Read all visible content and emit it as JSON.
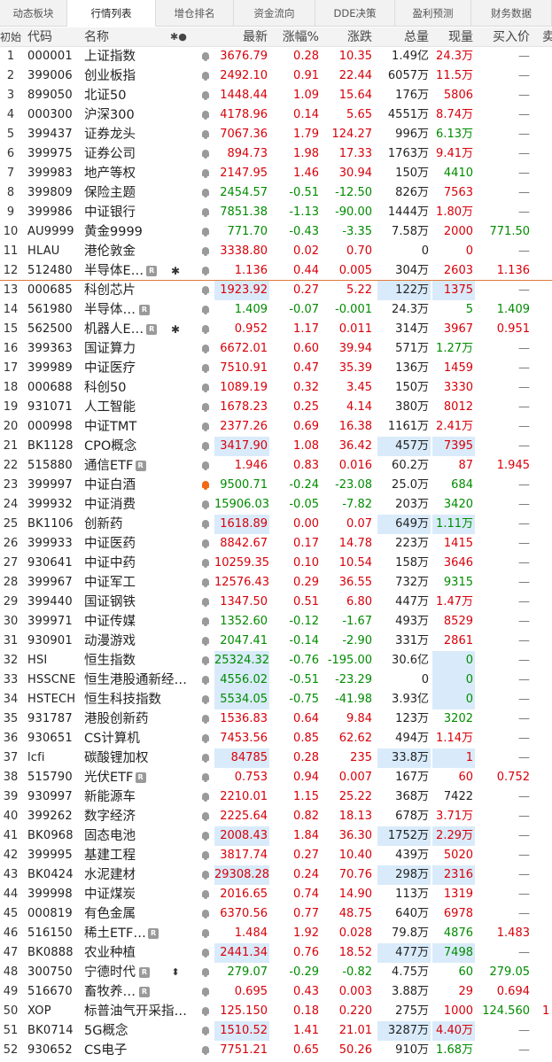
{
  "tabs": [
    "动态板块",
    "行情列表",
    "增仓排名",
    "资金流向",
    "DDE决策",
    "盈利预测",
    "财务数据"
  ],
  "active_tab": 1,
  "header": {
    "idx": "初始",
    "code": "代码",
    "name": "名称",
    "marks": "✱●",
    "price": "最新",
    "pct": "涨幅%",
    "chg": "涨跌",
    "vol": "总量",
    "now": "现量",
    "bid": "买入价",
    "extra": "卖"
  },
  "colors": {
    "up": "#d8000a",
    "down": "#008c00",
    "flat": "#222222",
    "highlight": "#d9ebfa",
    "separator": "#e07a3b",
    "alert_bell": "#f06a14"
  },
  "rows": [
    {
      "idx": "1",
      "code": "000001",
      "name": "上证指数",
      "price": "3676.79",
      "pct": "0.28",
      "chg": "10.35",
      "vol": "1.49亿",
      "now": "24.3万",
      "bid": "—",
      "dir": "up",
      "now_dir": "up"
    },
    {
      "idx": "2",
      "code": "399006",
      "name": "创业板指",
      "price": "2492.10",
      "pct": "0.91",
      "chg": "22.44",
      "vol": "6057万",
      "now": "11.5万",
      "bid": "—",
      "dir": "up",
      "now_dir": "up"
    },
    {
      "idx": "3",
      "code": "899050",
      "name": "北证50",
      "price": "1448.44",
      "pct": "1.09",
      "chg": "15.64",
      "vol": "176万",
      "now": "5806",
      "bid": "—",
      "dir": "up",
      "now_dir": "up"
    },
    {
      "idx": "4",
      "code": "000300",
      "name": "沪深300",
      "price": "4178.96",
      "pct": "0.14",
      "chg": "5.65",
      "vol": "4551万",
      "now": "8.74万",
      "bid": "—",
      "dir": "up",
      "now_dir": "up"
    },
    {
      "idx": "5",
      "code": "399437",
      "name": "证券龙头",
      "price": "7067.36",
      "pct": "1.79",
      "chg": "124.27",
      "vol": "996万",
      "now": "6.13万",
      "bid": "—",
      "dir": "up",
      "now_dir": "down"
    },
    {
      "idx": "6",
      "code": "399975",
      "name": "证券公司",
      "price": "894.73",
      "pct": "1.98",
      "chg": "17.33",
      "vol": "1763万",
      "now": "9.41万",
      "bid": "—",
      "dir": "up",
      "now_dir": "up"
    },
    {
      "idx": "7",
      "code": "399983",
      "name": "地产等权",
      "price": "2147.95",
      "pct": "1.46",
      "chg": "30.94",
      "vol": "150万",
      "now": "4410",
      "bid": "—",
      "dir": "up",
      "now_dir": "down"
    },
    {
      "idx": "8",
      "code": "399809",
      "name": "保险主题",
      "price": "2454.57",
      "pct": "-0.51",
      "chg": "-12.50",
      "vol": "826万",
      "now": "7563",
      "bid": "—",
      "dir": "down",
      "now_dir": "up"
    },
    {
      "idx": "9",
      "code": "399986",
      "name": "中证银行",
      "price": "7851.38",
      "pct": "-1.13",
      "chg": "-90.00",
      "vol": "1444万",
      "now": "1.80万",
      "bid": "—",
      "dir": "down",
      "now_dir": "up"
    },
    {
      "idx": "10",
      "code": "AU9999",
      "name": "黄金9999",
      "price": "771.70",
      "pct": "-0.43",
      "chg": "-3.35",
      "vol": "7.58万",
      "now": "2000",
      "bid": "771.50",
      "dir": "down",
      "now_dir": "up",
      "bid_dir": "down"
    },
    {
      "idx": "11",
      "code": "HLAU",
      "name": "港伦敦金",
      "price": "3338.80",
      "pct": "0.02",
      "chg": "0.70",
      "vol": "0",
      "now": "0",
      "bid": "—",
      "dir": "up",
      "now_dir": "up"
    },
    {
      "idx": "12",
      "code": "512480",
      "name": "半导体E…",
      "badge": "R",
      "star": "✱",
      "price": "1.136",
      "pct": "0.44",
      "chg": "0.005",
      "vol": "304万",
      "now": "2603",
      "bid": "1.136",
      "dir": "up",
      "now_dir": "up",
      "bid_dir": "up",
      "sep": true
    },
    {
      "idx": "13",
      "code": "000685",
      "name": "科创芯片",
      "price": "1923.92",
      "pct": "0.27",
      "chg": "5.22",
      "vol": "122万",
      "now": "1375",
      "bid": "—",
      "dir": "up",
      "now_dir": "up",
      "hl_price": true,
      "hl_vol": true,
      "hl_now": true
    },
    {
      "idx": "14",
      "code": "561980",
      "name": "半导体…",
      "badge": "R",
      "price": "1.409",
      "pct": "-0.07",
      "chg": "-0.001",
      "vol": "24.3万",
      "now": "5",
      "bid": "1.409",
      "dir": "down",
      "now_dir": "down",
      "bid_dir": "down"
    },
    {
      "idx": "15",
      "code": "562500",
      "name": "机器人E…",
      "badge": "R",
      "star": "✱",
      "price": "0.952",
      "pct": "1.17",
      "chg": "0.011",
      "vol": "314万",
      "now": "3967",
      "bid": "0.951",
      "dir": "up",
      "now_dir": "up",
      "bid_dir": "up"
    },
    {
      "idx": "16",
      "code": "399363",
      "name": "国证算力",
      "price": "6672.01",
      "pct": "0.60",
      "chg": "39.94",
      "vol": "571万",
      "now": "1.27万",
      "bid": "—",
      "dir": "up",
      "now_dir": "down"
    },
    {
      "idx": "17",
      "code": "399989",
      "name": "中证医疗",
      "price": "7510.91",
      "pct": "0.47",
      "chg": "35.39",
      "vol": "136万",
      "now": "1459",
      "bid": "—",
      "dir": "up",
      "now_dir": "up"
    },
    {
      "idx": "18",
      "code": "000688",
      "name": "科创50",
      "price": "1089.19",
      "pct": "0.32",
      "chg": "3.45",
      "vol": "150万",
      "now": "3330",
      "bid": "—",
      "dir": "up",
      "now_dir": "up"
    },
    {
      "idx": "19",
      "code": "931071",
      "name": "人工智能",
      "price": "1678.23",
      "pct": "0.25",
      "chg": "4.14",
      "vol": "380万",
      "now": "8012",
      "bid": "—",
      "dir": "up",
      "now_dir": "up"
    },
    {
      "idx": "20",
      "code": "000998",
      "name": "中证TMT",
      "price": "2377.26",
      "pct": "0.69",
      "chg": "16.38",
      "vol": "1161万",
      "now": "2.41万",
      "bid": "—",
      "dir": "up",
      "now_dir": "up"
    },
    {
      "idx": "21",
      "code": "BK1128",
      "name": "CPO概念",
      "price": "3417.90",
      "pct": "1.08",
      "chg": "36.42",
      "vol": "457万",
      "now": "7395",
      "bid": "—",
      "dir": "up",
      "now_dir": "up",
      "hl_price": true,
      "hl_vol": true,
      "hl_now": true
    },
    {
      "idx": "22",
      "code": "515880",
      "name": "通信ETF",
      "badge": "R",
      "price": "1.946",
      "pct": "0.83",
      "chg": "0.016",
      "vol": "60.2万",
      "now": "87",
      "bid": "1.945",
      "dir": "up",
      "now_dir": "up",
      "bid_dir": "up"
    },
    {
      "idx": "23",
      "code": "399997",
      "name": "中证白酒",
      "alert": true,
      "price": "9500.71",
      "pct": "-0.24",
      "chg": "-23.08",
      "vol": "25.0万",
      "now": "684",
      "bid": "—",
      "dir": "down",
      "now_dir": "down"
    },
    {
      "idx": "24",
      "code": "399932",
      "name": "中证消费",
      "price": "15906.03",
      "pct": "-0.05",
      "chg": "-7.82",
      "vol": "203万",
      "now": "3420",
      "bid": "—",
      "dir": "down",
      "now_dir": "down"
    },
    {
      "idx": "25",
      "code": "BK1106",
      "name": "创新药",
      "price": "1618.89",
      "pct": "0.00",
      "chg": "0.07",
      "vol": "649万",
      "now": "1.11万",
      "bid": "—",
      "dir": "up",
      "now_dir": "down",
      "hl_price": true,
      "hl_vol": true,
      "hl_now": true
    },
    {
      "idx": "26",
      "code": "399933",
      "name": "中证医药",
      "price": "8842.67",
      "pct": "0.17",
      "chg": "14.78",
      "vol": "223万",
      "now": "1415",
      "bid": "—",
      "dir": "up",
      "now_dir": "up"
    },
    {
      "idx": "27",
      "code": "930641",
      "name": "中证中药",
      "price": "10259.35",
      "pct": "0.10",
      "chg": "10.54",
      "vol": "158万",
      "now": "3646",
      "bid": "—",
      "dir": "up",
      "now_dir": "up"
    },
    {
      "idx": "28",
      "code": "399967",
      "name": "中证军工",
      "price": "12576.43",
      "pct": "0.29",
      "chg": "36.55",
      "vol": "732万",
      "now": "9315",
      "bid": "—",
      "dir": "up",
      "now_dir": "down"
    },
    {
      "idx": "29",
      "code": "399440",
      "name": "国证钢铁",
      "price": "1347.50",
      "pct": "0.51",
      "chg": "6.80",
      "vol": "447万",
      "now": "1.47万",
      "bid": "—",
      "dir": "up",
      "now_dir": "up"
    },
    {
      "idx": "30",
      "code": "399971",
      "name": "中证传媒",
      "price": "1352.60",
      "pct": "-0.12",
      "chg": "-1.67",
      "vol": "493万",
      "now": "8529",
      "bid": "—",
      "dir": "down",
      "now_dir": "up"
    },
    {
      "idx": "31",
      "code": "930901",
      "name": "动漫游戏",
      "price": "2047.41",
      "pct": "-0.14",
      "chg": "-2.90",
      "vol": "331万",
      "now": "2861",
      "bid": "—",
      "dir": "down",
      "now_dir": "up"
    },
    {
      "idx": "32",
      "code": "HSI",
      "name": "恒生指数",
      "price": "25324.32",
      "pct": "-0.76",
      "chg": "-195.00",
      "vol": "30.6亿",
      "now": "0",
      "bid": "—",
      "dir": "down",
      "now_dir": "down",
      "hl_price": true,
      "hl_now": true
    },
    {
      "idx": "33",
      "code": "HSSCNE",
      "name": "恒生港股通新经…",
      "price": "4556.02",
      "pct": "-0.51",
      "chg": "-23.29",
      "vol": "0",
      "now": "0",
      "bid": "—",
      "dir": "down",
      "now_dir": "down",
      "hl_price": true,
      "hl_now": true
    },
    {
      "idx": "34",
      "code": "HSTECH",
      "name": "恒生科技指数",
      "price": "5534.05",
      "pct": "-0.75",
      "chg": "-41.98",
      "vol": "3.93亿",
      "now": "0",
      "bid": "—",
      "dir": "down",
      "now_dir": "down",
      "hl_price": true,
      "hl_now": true
    },
    {
      "idx": "35",
      "code": "931787",
      "name": "港股创新药",
      "price": "1536.83",
      "pct": "0.64",
      "chg": "9.84",
      "vol": "123万",
      "now": "3202",
      "bid": "—",
      "dir": "up",
      "now_dir": "down"
    },
    {
      "idx": "36",
      "code": "930651",
      "name": "CS计算机",
      "price": "7453.56",
      "pct": "0.85",
      "chg": "62.62",
      "vol": "494万",
      "now": "1.14万",
      "bid": "—",
      "dir": "up",
      "now_dir": "up"
    },
    {
      "idx": "37",
      "code": "lcfi",
      "name": "碳酸锂加权",
      "price": "84785",
      "pct": "0.28",
      "chg": "235",
      "vol": "33.8万",
      "now": "1",
      "bid": "—",
      "dir": "up",
      "now_dir": "up",
      "hl_price": true,
      "hl_vol": true,
      "hl_now": true
    },
    {
      "idx": "38",
      "code": "515790",
      "name": "光伏ETF",
      "badge": "R",
      "price": "0.753",
      "pct": "0.94",
      "chg": "0.007",
      "vol": "167万",
      "now": "60",
      "bid": "0.752",
      "dir": "up",
      "now_dir": "up",
      "bid_dir": "up"
    },
    {
      "idx": "39",
      "code": "930997",
      "name": "新能源车",
      "price": "2210.01",
      "pct": "1.15",
      "chg": "25.22",
      "vol": "368万",
      "now": "7422",
      "bid": "—",
      "dir": "up",
      "now_dir": "black"
    },
    {
      "idx": "40",
      "code": "399262",
      "name": "数字经济",
      "price": "2225.64",
      "pct": "0.82",
      "chg": "18.13",
      "vol": "678万",
      "now": "3.71万",
      "bid": "—",
      "dir": "up",
      "now_dir": "up"
    },
    {
      "idx": "41",
      "code": "BK0968",
      "name": "固态电池",
      "price": "2008.43",
      "pct": "1.84",
      "chg": "36.30",
      "vol": "1752万",
      "now": "2.29万",
      "bid": "—",
      "dir": "up",
      "now_dir": "up",
      "hl_price": true,
      "hl_vol": true,
      "hl_now": true
    },
    {
      "idx": "42",
      "code": "399995",
      "name": "基建工程",
      "price": "3817.74",
      "pct": "0.27",
      "chg": "10.40",
      "vol": "439万",
      "now": "5020",
      "bid": "—",
      "dir": "up",
      "now_dir": "up"
    },
    {
      "idx": "43",
      "code": "BK0424",
      "name": "水泥建材",
      "price": "29308.28",
      "pct": "0.24",
      "chg": "70.76",
      "vol": "298万",
      "now": "2316",
      "bid": "—",
      "dir": "up",
      "now_dir": "up",
      "hl_price": true,
      "hl_vol": true,
      "hl_now": true
    },
    {
      "idx": "44",
      "code": "399998",
      "name": "中证煤炭",
      "price": "2016.65",
      "pct": "0.74",
      "chg": "14.90",
      "vol": "113万",
      "now": "1319",
      "bid": "—",
      "dir": "up",
      "now_dir": "up"
    },
    {
      "idx": "45",
      "code": "000819",
      "name": "有色金属",
      "price": "6370.56",
      "pct": "0.77",
      "chg": "48.75",
      "vol": "640万",
      "now": "6978",
      "bid": "—",
      "dir": "up",
      "now_dir": "up"
    },
    {
      "idx": "46",
      "code": "516150",
      "name": "稀土ETF…",
      "badge": "R",
      "price": "1.484",
      "pct": "1.92",
      "chg": "0.028",
      "vol": "79.8万",
      "now": "4876",
      "bid": "1.483",
      "dir": "up",
      "now_dir": "down",
      "bid_dir": "up"
    },
    {
      "idx": "47",
      "code": "BK0888",
      "name": "农业种植",
      "price": "2441.34",
      "pct": "0.76",
      "chg": "18.52",
      "vol": "477万",
      "now": "7498",
      "bid": "—",
      "dir": "up",
      "now_dir": "down",
      "hl_price": true,
      "hl_vol": true,
      "hl_now": true
    },
    {
      "idx": "48",
      "code": "300750",
      "name": "宁德时代",
      "badge": "R",
      "sort": "⬍",
      "price": "279.07",
      "pct": "-0.29",
      "chg": "-0.82",
      "vol": "4.75万",
      "now": "60",
      "bid": "279.05",
      "dir": "down",
      "now_dir": "down",
      "bid_dir": "down"
    },
    {
      "idx": "49",
      "code": "516670",
      "name": "畜牧养…",
      "badge": "R",
      "price": "0.695",
      "pct": "0.43",
      "chg": "0.003",
      "vol": "3.88万",
      "now": "29",
      "bid": "0.694",
      "dir": "up",
      "now_dir": "up",
      "bid_dir": "up"
    },
    {
      "idx": "50",
      "code": "XOP",
      "name": "标普油气开采指…",
      "price": "125.150",
      "pct": "0.18",
      "chg": "0.220",
      "vol": "275万",
      "now": "1000",
      "bid": "124.560",
      "dir": "up",
      "now_dir": "up",
      "bid_dir": "down",
      "extra": "1"
    },
    {
      "idx": "51",
      "code": "BK0714",
      "name": "5G概念",
      "price": "1510.52",
      "pct": "1.41",
      "chg": "21.01",
      "vol": "3287万",
      "now": "4.40万",
      "bid": "—",
      "dir": "up",
      "now_dir": "up",
      "hl_price": true,
      "hl_vol": true,
      "hl_now": true
    },
    {
      "idx": "52",
      "code": "930652",
      "name": "CS电子",
      "price": "7751.21",
      "pct": "0.65",
      "chg": "50.26",
      "vol": "910万",
      "now": "1.68万",
      "bid": "—",
      "dir": "up",
      "now_dir": "down"
    }
  ]
}
